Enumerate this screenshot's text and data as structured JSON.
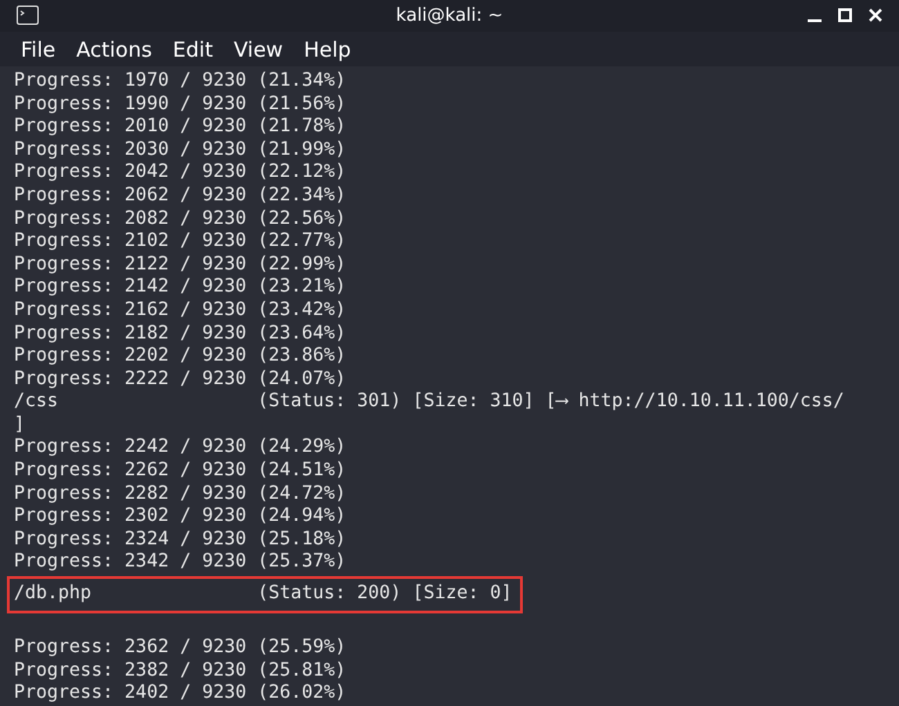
{
  "window": {
    "title": "kali@kali: ~"
  },
  "menu": [
    "File",
    "Actions",
    "Edit",
    "View",
    "Help"
  ],
  "lines": [
    {
      "kind": "text",
      "text": "Progress: 1970 / 9230 (21.34%)",
      "highlighted": false
    },
    {
      "kind": "text",
      "text": "Progress: 1990 / 9230 (21.56%)",
      "highlighted": false
    },
    {
      "kind": "text",
      "text": "Progress: 2010 / 9230 (21.78%)",
      "highlighted": false
    },
    {
      "kind": "text",
      "text": "Progress: 2030 / 9230 (21.99%)",
      "highlighted": false
    },
    {
      "kind": "text",
      "text": "Progress: 2042 / 9230 (22.12%)",
      "highlighted": false
    },
    {
      "kind": "text",
      "text": "Progress: 2062 / 9230 (22.34%)",
      "highlighted": false
    },
    {
      "kind": "text",
      "text": "Progress: 2082 / 9230 (22.56%)",
      "highlighted": false
    },
    {
      "kind": "text",
      "text": "Progress: 2102 / 9230 (22.77%)",
      "highlighted": false
    },
    {
      "kind": "text",
      "text": "Progress: 2122 / 9230 (22.99%)",
      "highlighted": false
    },
    {
      "kind": "text",
      "text": "Progress: 2142 / 9230 (23.21%)",
      "highlighted": false
    },
    {
      "kind": "text",
      "text": "Progress: 2162 / 9230 (23.42%)",
      "highlighted": false
    },
    {
      "kind": "text",
      "text": "Progress: 2182 / 9230 (23.64%)",
      "highlighted": false
    },
    {
      "kind": "text",
      "text": "Progress: 2202 / 9230 (23.86%)",
      "highlighted": false
    },
    {
      "kind": "text",
      "text": "Progress: 2222 / 9230 (24.07%)",
      "highlighted": false
    },
    {
      "kind": "text",
      "text": "/css                  (Status: 301) [Size: 310] [⟶ http://10.10.11.100/css/",
      "highlighted": false
    },
    {
      "kind": "text",
      "text": "]",
      "highlighted": false
    },
    {
      "kind": "text",
      "text": "Progress: 2242 / 9230 (24.29%)",
      "highlighted": false
    },
    {
      "kind": "text",
      "text": "Progress: 2262 / 9230 (24.51%)",
      "highlighted": false
    },
    {
      "kind": "text",
      "text": "Progress: 2282 / 9230 (24.72%)",
      "highlighted": false
    },
    {
      "kind": "text",
      "text": "Progress: 2302 / 9230 (24.94%)",
      "highlighted": false
    },
    {
      "kind": "text",
      "text": "Progress: 2324 / 9230 (25.18%)",
      "highlighted": false
    },
    {
      "kind": "text",
      "text": "Progress: 2342 / 9230 (25.37%)",
      "highlighted": false
    },
    {
      "kind": "text",
      "text": "/db.php               (Status: 200) [Size: 0]",
      "highlighted": true
    },
    {
      "kind": "blank"
    },
    {
      "kind": "text",
      "text": "Progress: 2362 / 9230 (25.59%)",
      "highlighted": false
    },
    {
      "kind": "text",
      "text": "Progress: 2382 / 9230 (25.81%)",
      "highlighted": false
    },
    {
      "kind": "text",
      "text": "Progress: 2402 / 9230 (26.02%)",
      "highlighted": false
    }
  ]
}
